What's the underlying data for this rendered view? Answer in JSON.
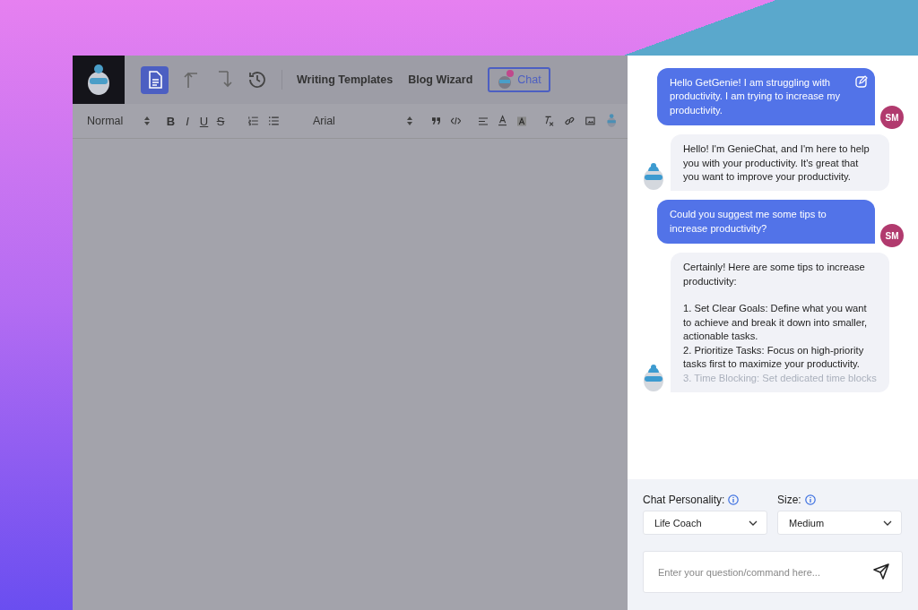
{
  "toolbar": {
    "nav_links": [
      "Writing Templates",
      "Blog Wizard"
    ],
    "chat_button": "Chat"
  },
  "format_bar": {
    "style_select": "Normal",
    "marks": [
      {
        "label": "B",
        "kind": "bold"
      },
      {
        "label": "I",
        "kind": "italic"
      },
      {
        "label": "U",
        "kind": "underline"
      },
      {
        "label": "S",
        "kind": "strike"
      }
    ],
    "font_select": "Arial"
  },
  "messages": [
    {
      "kind": "user",
      "text": "Hello GetGenie! I am struggling with productivity. I am trying to increase my productivity.",
      "avatar": "SM",
      "edit_icon": true
    },
    {
      "kind": "bot",
      "text": "Hello! I'm GenieChat, and I'm here to help you with your productivity. It's great that you want to improve your productivity."
    },
    {
      "kind": "user",
      "text": "Could you suggest me some tips to increase productivity?",
      "avatar": "SM",
      "edit_icon": false
    },
    {
      "kind": "bot",
      "text": "Certainly! Here are some tips to increase productivity:\n\n1. Set Clear Goals: Define what you want to achieve and break it down into smaller, actionable tasks.\n2. Prioritize Tasks: Focus on high-priority tasks first to maximize your productivity.",
      "faded_text": "3. Time Blocking: Set dedicated time blocks"
    }
  ],
  "settings": {
    "personality_label": "Chat Personality:",
    "personality": "Life Coach",
    "size_label": "Size:",
    "size": "Medium"
  },
  "input": {
    "placeholder": "Enter your question/command here..."
  }
}
